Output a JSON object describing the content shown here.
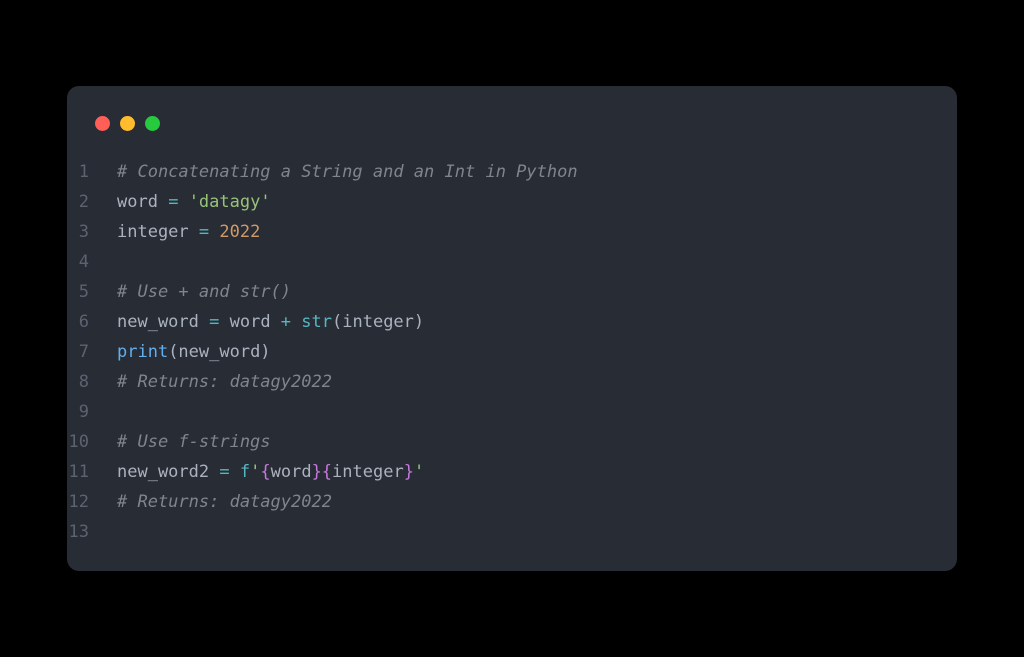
{
  "colors": {
    "background": "#000000",
    "window_bg": "#282c34",
    "dot_red": "#ff5f56",
    "dot_yellow": "#ffbd2e",
    "dot_green": "#27c93f",
    "comment": "#7f848e",
    "variable": "#e06c75",
    "operator": "#56b6c2",
    "string": "#98c379",
    "number": "#d19a66",
    "function": "#61afef",
    "default": "#abb2bf",
    "fbrace": "#c678dd"
  },
  "code": {
    "lines": [
      {
        "num": "1",
        "tokens": [
          {
            "cls": "tok-comment",
            "text": "# Concatenating a String and an Int in Python"
          }
        ]
      },
      {
        "num": "2",
        "tokens": [
          {
            "cls": "tok-default",
            "text": "word "
          },
          {
            "cls": "tok-operator",
            "text": "="
          },
          {
            "cls": "tok-default",
            "text": " "
          },
          {
            "cls": "tok-string",
            "text": "'datagy'"
          }
        ]
      },
      {
        "num": "3",
        "tokens": [
          {
            "cls": "tok-default",
            "text": "integer "
          },
          {
            "cls": "tok-operator",
            "text": "="
          },
          {
            "cls": "tok-default",
            "text": " "
          },
          {
            "cls": "tok-number",
            "text": "2022"
          }
        ]
      },
      {
        "num": "4",
        "tokens": []
      },
      {
        "num": "5",
        "tokens": [
          {
            "cls": "tok-comment",
            "text": "# Use + and str()"
          }
        ]
      },
      {
        "num": "6",
        "tokens": [
          {
            "cls": "tok-default",
            "text": "new_word "
          },
          {
            "cls": "tok-operator",
            "text": "="
          },
          {
            "cls": "tok-default",
            "text": " word "
          },
          {
            "cls": "tok-operator",
            "text": "+"
          },
          {
            "cls": "tok-default",
            "text": " "
          },
          {
            "cls": "tok-builtin",
            "text": "str"
          },
          {
            "cls": "tok-punct",
            "text": "(integer)"
          }
        ]
      },
      {
        "num": "7",
        "tokens": [
          {
            "cls": "tok-func",
            "text": "print"
          },
          {
            "cls": "tok-punct",
            "text": "(new_word)"
          }
        ]
      },
      {
        "num": "8",
        "tokens": [
          {
            "cls": "tok-comment",
            "text": "# Returns: datagy2022"
          }
        ]
      },
      {
        "num": "9",
        "tokens": []
      },
      {
        "num": "10",
        "tokens": [
          {
            "cls": "tok-comment",
            "text": "# Use f-strings"
          }
        ]
      },
      {
        "num": "11",
        "tokens": [
          {
            "cls": "tok-default",
            "text": "new_word2 "
          },
          {
            "cls": "tok-operator",
            "text": "="
          },
          {
            "cls": "tok-default",
            "text": " "
          },
          {
            "cls": "tok-fprefix",
            "text": "f"
          },
          {
            "cls": "tok-string",
            "text": "'"
          },
          {
            "cls": "tok-fstring-brace",
            "text": "{"
          },
          {
            "cls": "tok-default",
            "text": "word"
          },
          {
            "cls": "tok-fstring-brace",
            "text": "}{"
          },
          {
            "cls": "tok-default",
            "text": "integer"
          },
          {
            "cls": "tok-fstring-brace",
            "text": "}"
          },
          {
            "cls": "tok-string",
            "text": "'"
          }
        ]
      },
      {
        "num": "12",
        "tokens": [
          {
            "cls": "tok-comment",
            "text": "# Returns: datagy2022"
          }
        ]
      },
      {
        "num": "13",
        "tokens": []
      }
    ]
  }
}
